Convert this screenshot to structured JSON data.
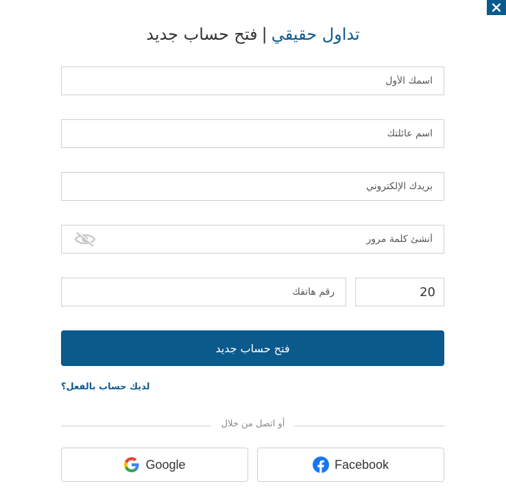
{
  "dialog": {
    "close_label": "×"
  },
  "title": {
    "accent": "تداول حقيقي",
    "separator": "|",
    "main": "فتح حساب جديد"
  },
  "fields": {
    "first_name": "اسمك الأول",
    "last_name": "اسم عائلتك",
    "email": "بريدك الإلكتروني",
    "password": "أنشئ كلمة مرور",
    "phone": "رقم هاتفك",
    "country_code": "20"
  },
  "submit_label": "فتح حساب جديد",
  "login_link": "لديك حساب بالفعل؟",
  "divider_text": "أو اتصل من خلال",
  "social": {
    "google": "Google",
    "facebook": "Facebook"
  },
  "colors": {
    "accent": "#0b5a8c",
    "google_blue": "#4285F4",
    "google_red": "#EA4335",
    "google_yellow": "#FBBC05",
    "google_green": "#34A853",
    "facebook_blue": "#1877F2"
  }
}
